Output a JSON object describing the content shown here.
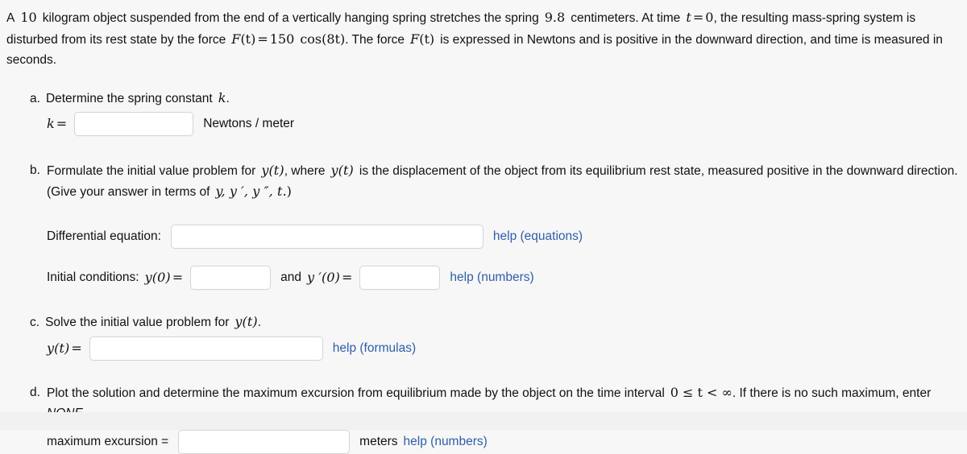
{
  "page": {
    "background": "#f7f7f7",
    "link_color": "#2f5ea8",
    "text_color": "#111111",
    "input_border_color": "#d5d5d5"
  },
  "intro": {
    "seg1": "A",
    "mass": "10",
    "seg2": "kilogram object suspended from the end of a vertically hanging spring stretches the spring",
    "stretch": "9.8",
    "seg3": "centimeters. At time",
    "time_var": "t",
    "eq": "=",
    "time_val": "0",
    "seg4": ", the resulting mass-spring system is disturbed from its rest state by the force",
    "force_F": "F",
    "force_arg": "(t)",
    "force_eq": "=",
    "force_amp": "150",
    "force_cos": "cos(8t)",
    "seg5": ". The force",
    "force_F2": "F",
    "force_arg2": "(t)",
    "seg6": "is expressed in Newtons and is positive in the downward direction, and time is measured in seconds."
  },
  "part_a": {
    "letter": "a.",
    "text": "Determine the spring constant",
    "var": "k",
    "period": ".",
    "k_label_var": "k",
    "k_label_eq": "=",
    "input_value": "",
    "input_placeholder": "",
    "unit": "Newtons / meter"
  },
  "part_b": {
    "letter": "b.",
    "text_1": "Formulate the initial value problem for",
    "var_yt_1": "y(t)",
    "text_2": ", where",
    "var_yt_2": "y(t)",
    "text_3": "is the displacement of the object from its equilibrium rest state, measured positive in the downward direction. (Give your answer in terms of",
    "vars_list": "y, y ′, y ″, t",
    "text_4": ".)",
    "de_label": "Differential equation:",
    "de_value": "",
    "de_help": "help (equations)",
    "ic_label": "Initial conditions:",
    "ic_y0": "y(0)",
    "ic_eq1": "=",
    "ic_y0_value": "",
    "ic_and": "and",
    "ic_yp0": "y ′(0)",
    "ic_eq2": "=",
    "ic_yp0_value": "",
    "ic_help": "help (numbers)"
  },
  "part_c": {
    "letter": "c.",
    "text": "Solve the initial value problem for",
    "var_yt": "y(t)",
    "period": ".",
    "answer_label_var": "y(t)",
    "answer_label_eq": "=",
    "input_value": "",
    "help": "help (formulas)"
  },
  "part_d": {
    "letter": "d.",
    "text_1": "Plot the solution and determine the maximum excursion from equilibrium made by the object on the time interval",
    "interval": "0 ≤ t < ∞",
    "text_2": ". If there is no such maximum, enter",
    "none_word": "NONE",
    "text_3": ".",
    "answer_label": "maximum excursion =",
    "input_value": "",
    "unit": "meters",
    "help": "help (numbers)"
  }
}
